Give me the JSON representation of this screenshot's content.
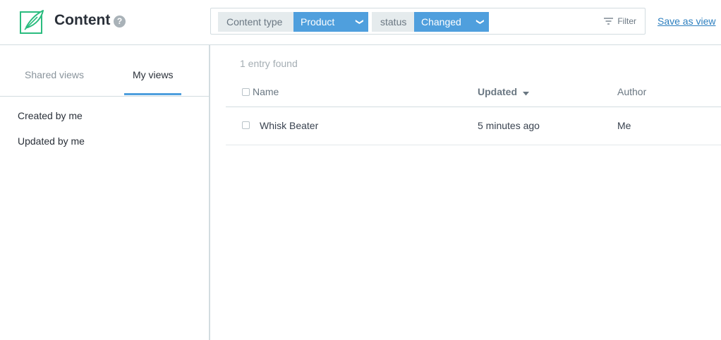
{
  "header": {
    "title": "Content",
    "help_icon": "?",
    "save_view_label": "Save as view"
  },
  "search": {
    "filters": [
      {
        "label": "Content type",
        "value": "Product"
      },
      {
        "label": "status",
        "value": "Changed"
      }
    ],
    "filter_label": "Filter"
  },
  "sidebar": {
    "tabs": [
      {
        "label": "Shared views",
        "active": false
      },
      {
        "label": "My views",
        "active": true
      }
    ],
    "items": [
      {
        "label": "Created by me"
      },
      {
        "label": "Updated by me"
      }
    ]
  },
  "main": {
    "count_text": "1 entry found",
    "columns": [
      {
        "label": "Name"
      },
      {
        "label": "Updated",
        "sorted": true
      },
      {
        "label": "Author"
      }
    ],
    "rows": [
      {
        "name": "Whisk Beater",
        "updated": "5 minutes ago",
        "author": "Me"
      }
    ]
  },
  "colors": {
    "accent": "#4f9fdd",
    "logo_green": "#2bbc7f",
    "border": "#d3dce0",
    "link": "#2d7fbf"
  },
  "icons": [
    "feather-logo-icon",
    "help-icon",
    "chevron-down-icon",
    "filter-icon",
    "sort-desc-icon",
    "checkbox-icon"
  ]
}
